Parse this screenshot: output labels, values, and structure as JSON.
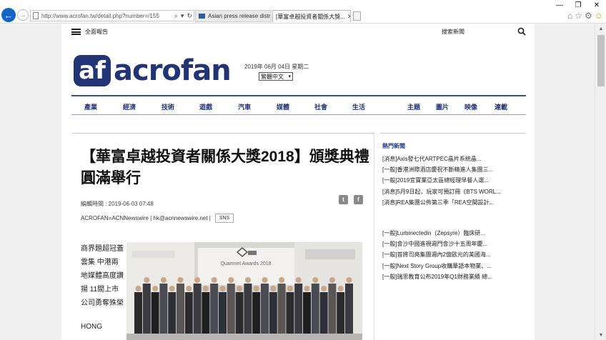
{
  "browser": {
    "url": "http://www.acrofan.tw/detail.php?number=/155",
    "tabs": [
      {
        "label": "Asian press release distribu..."
      },
      {
        "label": "[華富卓越投資者關係大獎..."
      }
    ]
  },
  "header": {
    "menu_label": "全面報告",
    "search_label": "搜索新聞",
    "logo_text": "acrofan",
    "logo_mark": "af",
    "date": "2019年 06月 04日 星期二",
    "language": "繁體中文"
  },
  "nav": {
    "items": [
      "產業",
      "經濟",
      "技術",
      "遊戲",
      "汽車",
      "媒體",
      "社會",
      "生活",
      "主題",
      "圖片",
      "映像",
      "連載"
    ]
  },
  "article": {
    "headline": "【華富卓越投資者關係大獎2018】頒獎典禮圓滿舉行",
    "edit_time": "編輯時間 : 2019-06-03 07:48",
    "byline": "ACROFAN=ACNNewswire | hk@acnnewswire.net |",
    "sns_label": "SNS",
    "body_paragraph_1": "商界題超冠蓋雲集 中港兩地媒體高度讚揚 11間上市公司勇奪殊榮",
    "body_paragraph_2": "HONG",
    "photo_backdrop_text": "Quamnet Awards 2018"
  },
  "sidebar": {
    "hot_title": "熱門新聞",
    "hot_news": [
      "[消息]Axis發七代ARTPEC晶片系統晶...",
      "[一般]香港洲際酒店慶祝不斷精進人集團三...",
      "[一般]2019宜寶業亞太區總經理早餐人選...",
      "[消息]5月9日起，玩家可預訂冊《BTS WORL...",
      "[消息]REA集團公佈第三季「REA空間設計..."
    ],
    "latest_news": [
      "[一般]Lurbinectedin（Zepsyre）臨床研...",
      "[一般]會沙中國進視週門會沙十五周年慶...",
      "[一般]首將司亮集團週內2億歐元的美國海...",
      "[一般]Next Story Group收購華語本物業、...",
      "[一般]瑞思教育公布2019年Q1財務業績 總..."
    ]
  },
  "colors": {
    "brand": "#233476",
    "nav_text": "#233476",
    "sidebar_title": "#1a3a8c"
  }
}
